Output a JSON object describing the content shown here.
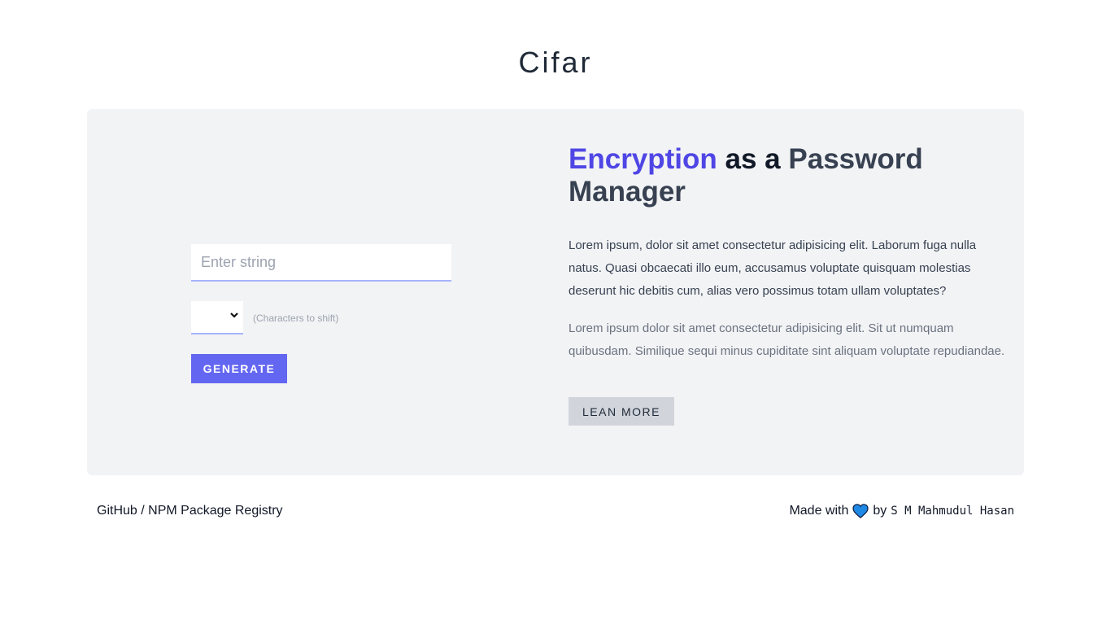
{
  "header": {
    "title": "Cifar"
  },
  "form": {
    "input_placeholder": "Enter string",
    "input_value": "",
    "shift_hint": "(Characters to shift)",
    "shift_value": "",
    "generate_label": "GENERATE"
  },
  "hero": {
    "title_accent": "Encryption",
    "title_mid": "as a",
    "title_rest": "Password Manager",
    "paragraph1": "Lorem ipsum, dolor sit amet consectetur adipisicing elit. Laborum fuga nulla natus. Quasi obcaecati illo eum, accusamus voluptate quisquam molestias deserunt hic debitis cum, alias vero possimus totam ullam voluptates?",
    "paragraph2": "Lorem ipsum dolor sit amet consectetur adipisicing elit. Sit ut numquam quibusdam. Similique sequi minus cupiditate sint aliquam voluptate repudiandae.",
    "learn_more_label": "LEAN MORE"
  },
  "footer": {
    "github_label": "GitHub",
    "separator": "/",
    "npm_label": "NPM Package Registry",
    "made_with": "Made with",
    "heart_icon": "heart-icon",
    "by": "by",
    "author": "S M Mahmudul Hasan"
  },
  "colors": {
    "accent": "#4f46e5",
    "button": "#6366f1",
    "card_bg": "#f2f3f5",
    "heart": "#1e88e5"
  }
}
